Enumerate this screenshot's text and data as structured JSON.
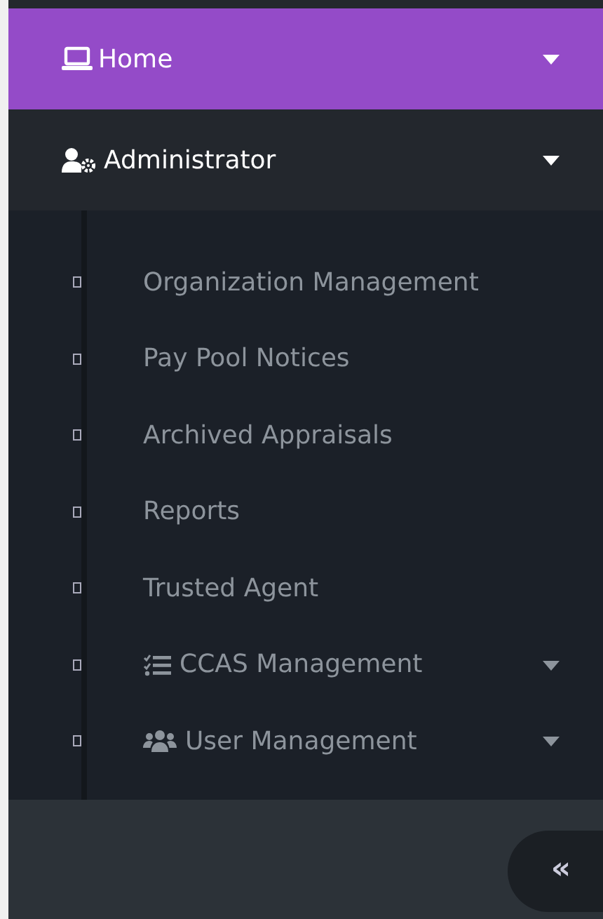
{
  "menu": [
    {
      "label": "Home",
      "selected": true
    },
    {
      "label": "Administrator",
      "selected": false,
      "children": [
        {
          "kind": "link",
          "label": "Organization Management"
        },
        {
          "kind": "link",
          "label": "Pay Pool Notices"
        },
        {
          "kind": "link",
          "label": "Archived Appraisals"
        },
        {
          "kind": "link",
          "label": "Reports"
        },
        {
          "kind": "link",
          "label": "Trusted Agent"
        },
        {
          "kind": "group",
          "label": "CCAS Management"
        },
        {
          "kind": "group",
          "label": "User Management"
        }
      ]
    }
  ],
  "collapse_button": {
    "label": "«"
  }
}
